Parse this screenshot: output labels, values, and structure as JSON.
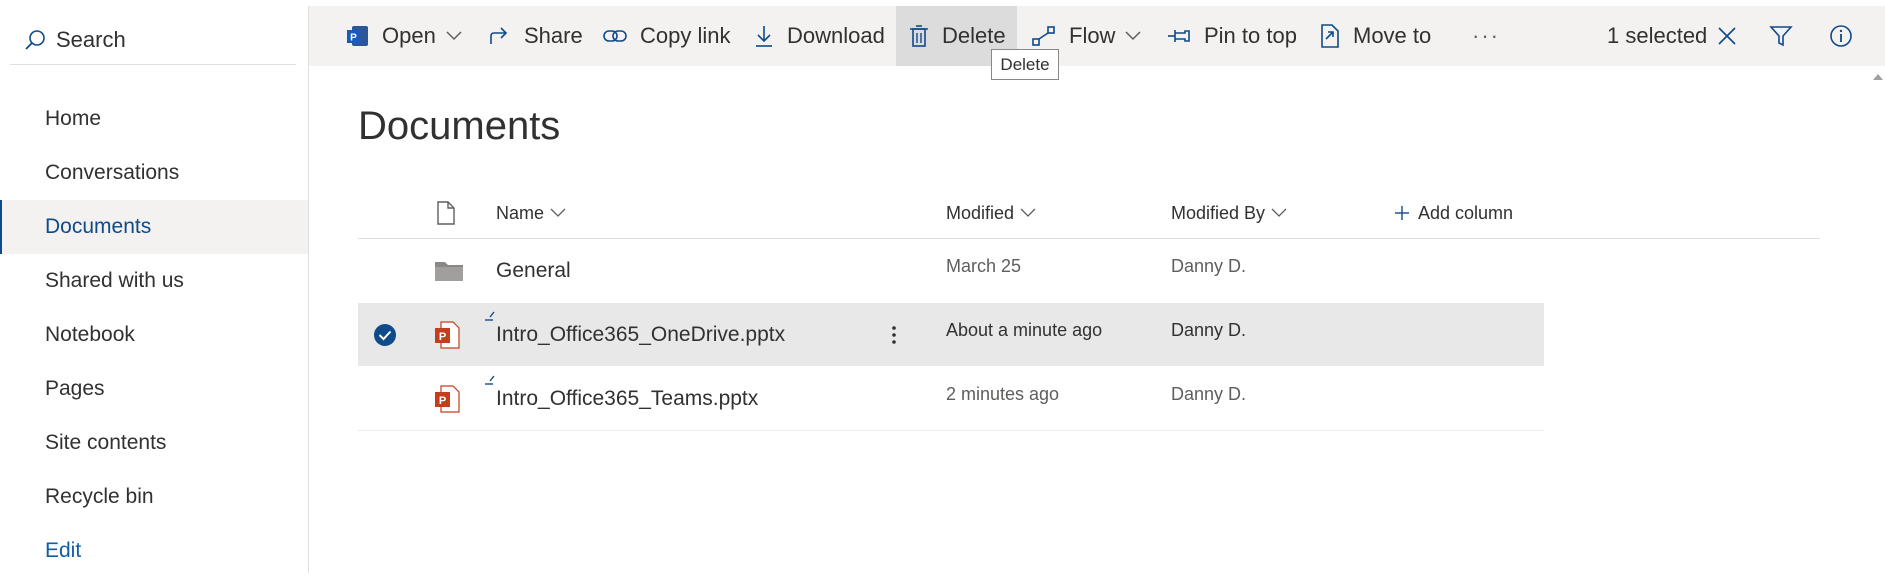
{
  "search": {
    "placeholder": "Search"
  },
  "nav": {
    "items": [
      {
        "label": "Home",
        "active": false
      },
      {
        "label": "Conversations",
        "active": false
      },
      {
        "label": "Documents",
        "active": true
      },
      {
        "label": "Shared with us",
        "active": false
      },
      {
        "label": "Notebook",
        "active": false
      },
      {
        "label": "Pages",
        "active": false
      },
      {
        "label": "Site contents",
        "active": false
      },
      {
        "label": "Recycle bin",
        "active": false
      }
    ],
    "edit_label": "Edit"
  },
  "commandbar": {
    "open": "Open",
    "share": "Share",
    "copy_link": "Copy link",
    "download": "Download",
    "delete": "Delete",
    "flow": "Flow",
    "pin_to_top": "Pin to top",
    "move_to": "Move to",
    "more": "···",
    "selected_count": "1 selected"
  },
  "tooltip": {
    "text": "Delete"
  },
  "page": {
    "title": "Documents"
  },
  "table": {
    "columns": {
      "name": "Name",
      "modified": "Modified",
      "modified_by": "Modified By",
      "add_column": "Add column"
    },
    "rows": [
      {
        "type": "folder",
        "name": "General",
        "modified": "March 25",
        "modified_by": "Danny D.",
        "selected": false
      },
      {
        "type": "pptx",
        "name": "Intro_Office365_OneDrive.pptx",
        "modified": "About a minute ago",
        "modified_by": "Danny D.",
        "selected": true
      },
      {
        "type": "pptx",
        "name": "Intro_Office365_Teams.pptx",
        "modified": "2 minutes ago",
        "modified_by": "Danny D.",
        "selected": false
      }
    ]
  },
  "colors": {
    "accent": "#0f4a8a",
    "commandbar_bg": "#f3f2f1",
    "selected_row": "#e8e8e8",
    "powerpoint": "#c43e1c"
  },
  "icons": [
    "search-icon",
    "open-in-app-icon",
    "share-icon",
    "link-icon",
    "download-icon",
    "delete-icon",
    "flow-icon",
    "pin-icon",
    "move-to-icon",
    "more-icon",
    "close-icon",
    "filter-icon",
    "info-icon",
    "document-icon",
    "folder-icon",
    "powerpoint-icon",
    "checkmark-icon",
    "new-indicator-icon",
    "row-more-icon"
  ]
}
